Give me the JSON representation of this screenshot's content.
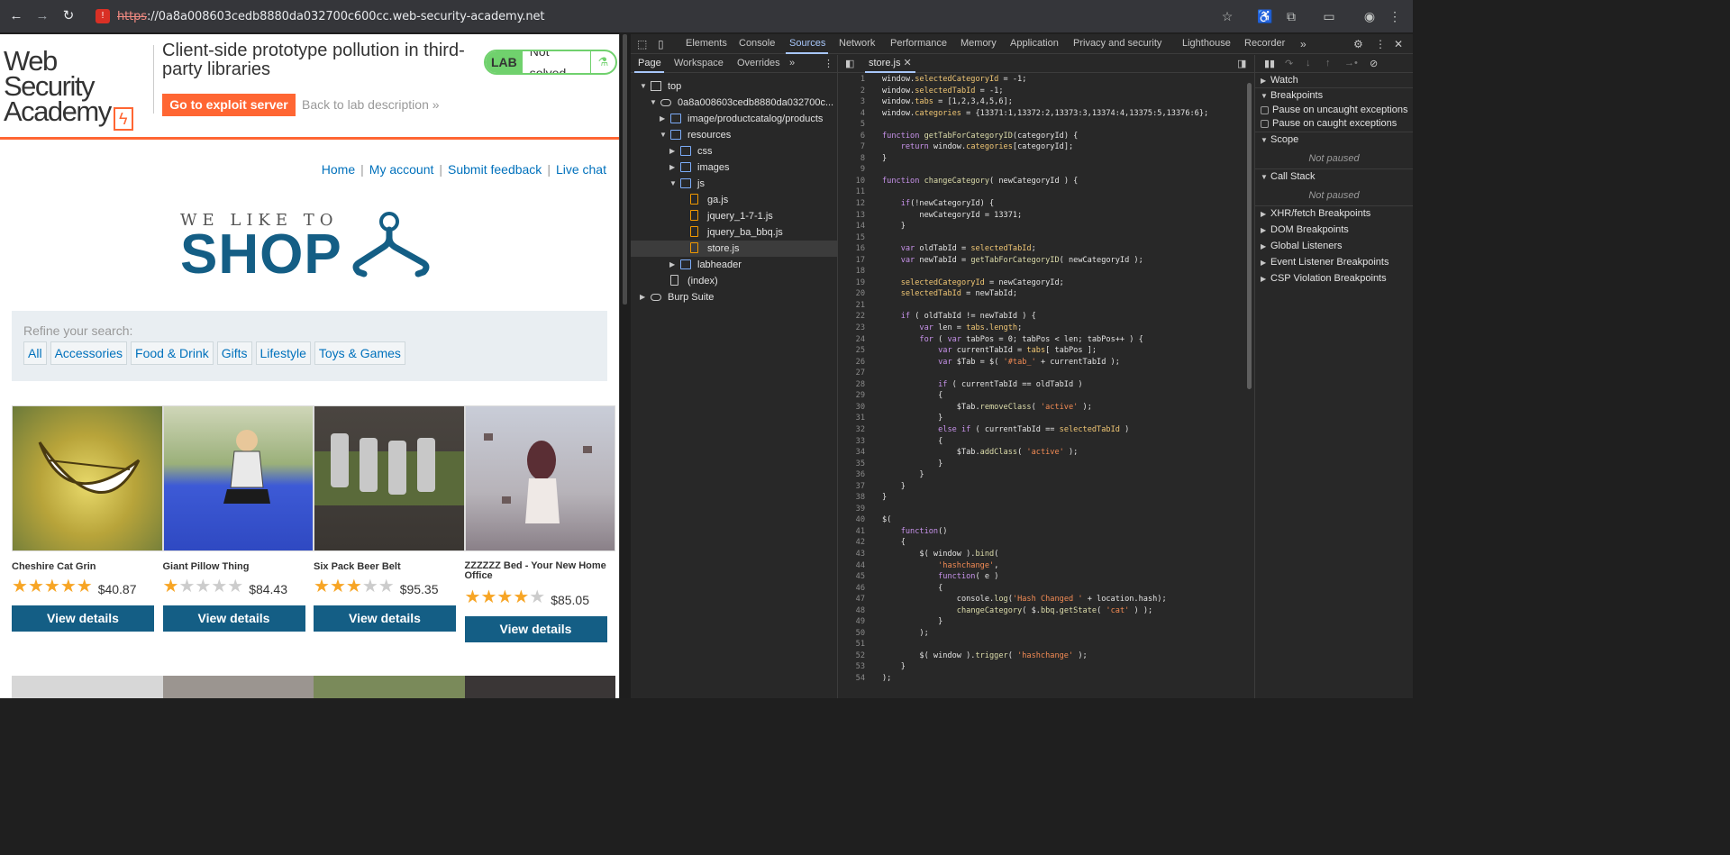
{
  "browser": {
    "url_protocol": "https",
    "url_rest": "://0a8a008603cedb8880da032700c600cc.web-security-academy.net"
  },
  "lab_header": {
    "logo_line1": "Web Security",
    "logo_line2": "Academy",
    "title": "Client-side prototype pollution in third-party libraries",
    "exploit_button": "Go to exploit server",
    "back_link": "Back to lab description",
    "back_chevron": "»",
    "badge": "LAB",
    "status": "Not solved"
  },
  "site": {
    "nav": [
      "Home",
      "My account",
      "Submit feedback",
      "Live chat"
    ],
    "nav_sep": "|",
    "banner_small": "WE LIKE TO",
    "banner_big": "SHOP",
    "refine_label": "Refine your search:",
    "filters": [
      "All",
      "Accessories",
      "Food & Drink",
      "Gifts",
      "Lifestyle",
      "Toys & Games"
    ],
    "products": [
      {
        "name": "Cheshire Cat Grin",
        "price": "$40.87",
        "rating": 5,
        "button": "View details",
        "image": "cheshire-cat-grin-image"
      },
      {
        "name": "Giant Pillow Thing",
        "price": "$84.43",
        "rating": 1,
        "button": "View details",
        "image": "giant-pillow-image"
      },
      {
        "name": "Six Pack Beer Belt",
        "price": "$95.35",
        "rating": 3,
        "button": "View details",
        "image": "beer-belt-image"
      },
      {
        "name": "ZZZZZZ Bed - Your New Home Office",
        "price": "$85.05",
        "rating": 4,
        "button": "View details",
        "image": "zzzzzz-bed-image"
      }
    ]
  },
  "devtools": {
    "tabs": [
      "Elements",
      "Console",
      "Sources",
      "Network",
      "Performance",
      "Memory",
      "Application",
      "Privacy and security",
      "Lighthouse",
      "Recorder"
    ],
    "active_tab": "Sources",
    "nav_subtabs": [
      "Page",
      "Workspace",
      "Overrides"
    ],
    "tree": [
      {
        "label": "top",
        "icon": "frame-icon",
        "indent": 0,
        "expanded": true
      },
      {
        "label": "0a8a008603cedb8880da032700c...",
        "icon": "cloud-icon",
        "indent": 1,
        "expanded": true
      },
      {
        "label": "image/productcatalog/products",
        "icon": "folder-icon",
        "indent": 2,
        "expanded": false
      },
      {
        "label": "resources",
        "icon": "folder-icon",
        "indent": 2,
        "expanded": true
      },
      {
        "label": "css",
        "icon": "folder-icon",
        "indent": 3,
        "expanded": false
      },
      {
        "label": "images",
        "icon": "folder-icon",
        "indent": 3,
        "expanded": false
      },
      {
        "label": "js",
        "icon": "folder-icon",
        "indent": 3,
        "expanded": true
      },
      {
        "label": "ga.js",
        "icon": "file-icon",
        "indent": 4
      },
      {
        "label": "jquery_1-7-1.js",
        "icon": "file-icon",
        "indent": 4
      },
      {
        "label": "jquery_ba_bbq.js",
        "icon": "file-icon",
        "indent": 4
      },
      {
        "label": "store.js",
        "icon": "file-icon",
        "indent": 4,
        "selected": true
      },
      {
        "label": "labheader",
        "icon": "folder-icon",
        "indent": 3,
        "expanded": false
      },
      {
        "label": "(index)",
        "icon": "document-icon",
        "indent": 2
      },
      {
        "label": "Burp Suite",
        "icon": "cloud-icon",
        "indent": 0,
        "expanded": false
      }
    ],
    "open_file": "store.js",
    "code_lines": [
      "window.selectedCategoryId = -1;",
      "window.selectedTabId = -1;",
      "window.tabs = [1,2,3,4,5,6];",
      "window.categories = {13371:1,13372:2,13373:3,13374:4,13375:5,13376:6};",
      "",
      "function getTabForCategoryID(categoryId) {",
      "    return window.categories[categoryId];",
      "}",
      "",
      "function changeCategory( newCategoryId ) {",
      "",
      "    if(!newCategoryId) {",
      "        newCategoryId = 13371;",
      "    }",
      "",
      "    var oldTabId = selectedTabId;",
      "    var newTabId = getTabForCategoryID( newCategoryId );",
      "",
      "    selectedCategoryId = newCategoryId;",
      "    selectedTabId = newTabId;",
      "",
      "    if ( oldTabId != newTabId ) {",
      "        var len = tabs.length;",
      "        for ( var tabPos = 0; tabPos < len; tabPos++ ) {",
      "            var currentTabId = tabs[ tabPos ];",
      "            var $Tab = $( '#tab_' + currentTabId );",
      "",
      "            if ( currentTabId == oldTabId )",
      "            {",
      "                $Tab.removeClass( 'active' );",
      "            }",
      "            else if ( currentTabId == selectedTabId )",
      "            {",
      "                $Tab.addClass( 'active' );",
      "            }",
      "        }",
      "    }",
      "}",
      "",
      "$(",
      "    function()",
      "    {",
      "        $( window ).bind(",
      "            'hashchange',",
      "            function( e )",
      "            {",
      "                console.log('Hash Changed ' + location.hash);",
      "                changeCategory( $.bbq.getState( 'cat' ) );",
      "            }",
      "        );",
      "",
      "        $( window ).trigger( 'hashchange' );",
      "    }",
      ");"
    ],
    "debugger": {
      "sections": [
        "Watch",
        "Breakpoints"
      ],
      "checkboxes": [
        "Pause on uncaught exceptions",
        "Pause on caught exceptions"
      ],
      "scope": "Scope",
      "call_stack": "Call Stack",
      "not_paused": "Not paused",
      "other_sections": [
        "XHR/fetch Breakpoints",
        "DOM Breakpoints",
        "Global Listeners",
        "Event Listener Breakpoints",
        "CSP Violation Breakpoints"
      ]
    }
  },
  "colors": {
    "accent": "#ff6633",
    "lab_green": "#70d16d",
    "primary_button": "#145e85",
    "link": "#0071bc",
    "star": "#f7a525"
  }
}
